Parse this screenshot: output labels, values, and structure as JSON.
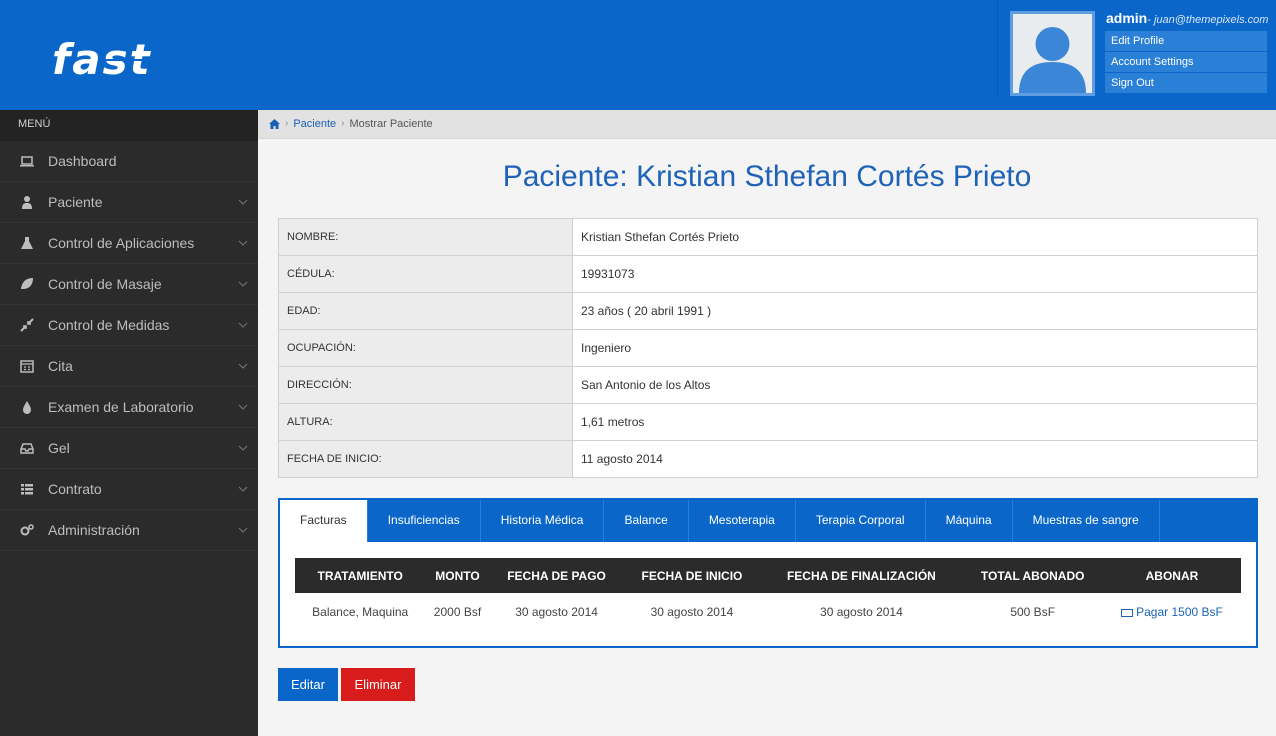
{
  "header": {
    "logo_text": "fast",
    "user": {
      "name": "admin",
      "email": "- juan@themepixels.com",
      "menu": [
        "Edit Profile",
        "Account Settings",
        "Sign Out"
      ]
    }
  },
  "sidebar": {
    "title": "MENÚ",
    "items": [
      {
        "label": "Dashboard",
        "icon": "laptop-icon"
      },
      {
        "label": "Paciente",
        "icon": "user-icon"
      },
      {
        "label": "Control de Aplicaciones",
        "icon": "flask-icon"
      },
      {
        "label": "Control de Masaje",
        "icon": "leaf-icon"
      },
      {
        "label": "Control de Medidas",
        "icon": "compress-icon"
      },
      {
        "label": "Cita",
        "icon": "calendar-icon"
      },
      {
        "label": "Examen de Laboratorio",
        "icon": "tint-icon"
      },
      {
        "label": "Gel",
        "icon": "inbox-icon"
      },
      {
        "label": "Contrato",
        "icon": "list-icon"
      },
      {
        "label": "Administración",
        "icon": "cogs-icon"
      }
    ]
  },
  "breadcrumb": {
    "link": "Paciente",
    "current": "Mostrar Paciente"
  },
  "page": {
    "title": "Paciente: Kristian Sthefan Cortés Prieto"
  },
  "patient": [
    {
      "label": "NOMBRE:",
      "value": "Kristian Sthefan Cortés Prieto"
    },
    {
      "label": "CÉDULA:",
      "value": "19931073"
    },
    {
      "label": "EDAD:",
      "value": "23 años ( 20 abril 1991 )"
    },
    {
      "label": "OCUPACIÓN:",
      "value": "Ingeniero"
    },
    {
      "label": "DIRECCIÓN:",
      "value": "San Antonio de los Altos"
    },
    {
      "label": "ALTURA:",
      "value": "1,61 metros"
    },
    {
      "label": "FECHA DE INICIO:",
      "value": "11 agosto 2014"
    }
  ],
  "tabs": [
    "Facturas",
    "Insuficiencias",
    "Historia Médica",
    "Balance",
    "Mesoterapia",
    "Terapia Corporal",
    "Máquina",
    "Muestras de sangre"
  ],
  "invoices": {
    "headers": [
      "TRATAMIENTO",
      "MONTO",
      "FECHA DE PAGO",
      "FECHA DE INICIO",
      "FECHA DE FINALIZACIÓN",
      "TOTAL ABONADO",
      "ABONAR"
    ],
    "rows": [
      {
        "tratamiento": "Balance, Maquina",
        "monto": "2000 Bsf",
        "fecha_pago": "30 agosto 2014",
        "fecha_inicio": "30 agosto 2014",
        "fecha_fin": "30 agosto 2014",
        "total": "500 BsF",
        "abonar": "Pagar 1500 BsF"
      }
    ]
  },
  "actions": {
    "edit": "Editar",
    "delete": "Eliminar"
  },
  "colors": {
    "primary": "#0a67c9",
    "sidebar": "#2b2b2b",
    "danger": "#d81c1c"
  }
}
